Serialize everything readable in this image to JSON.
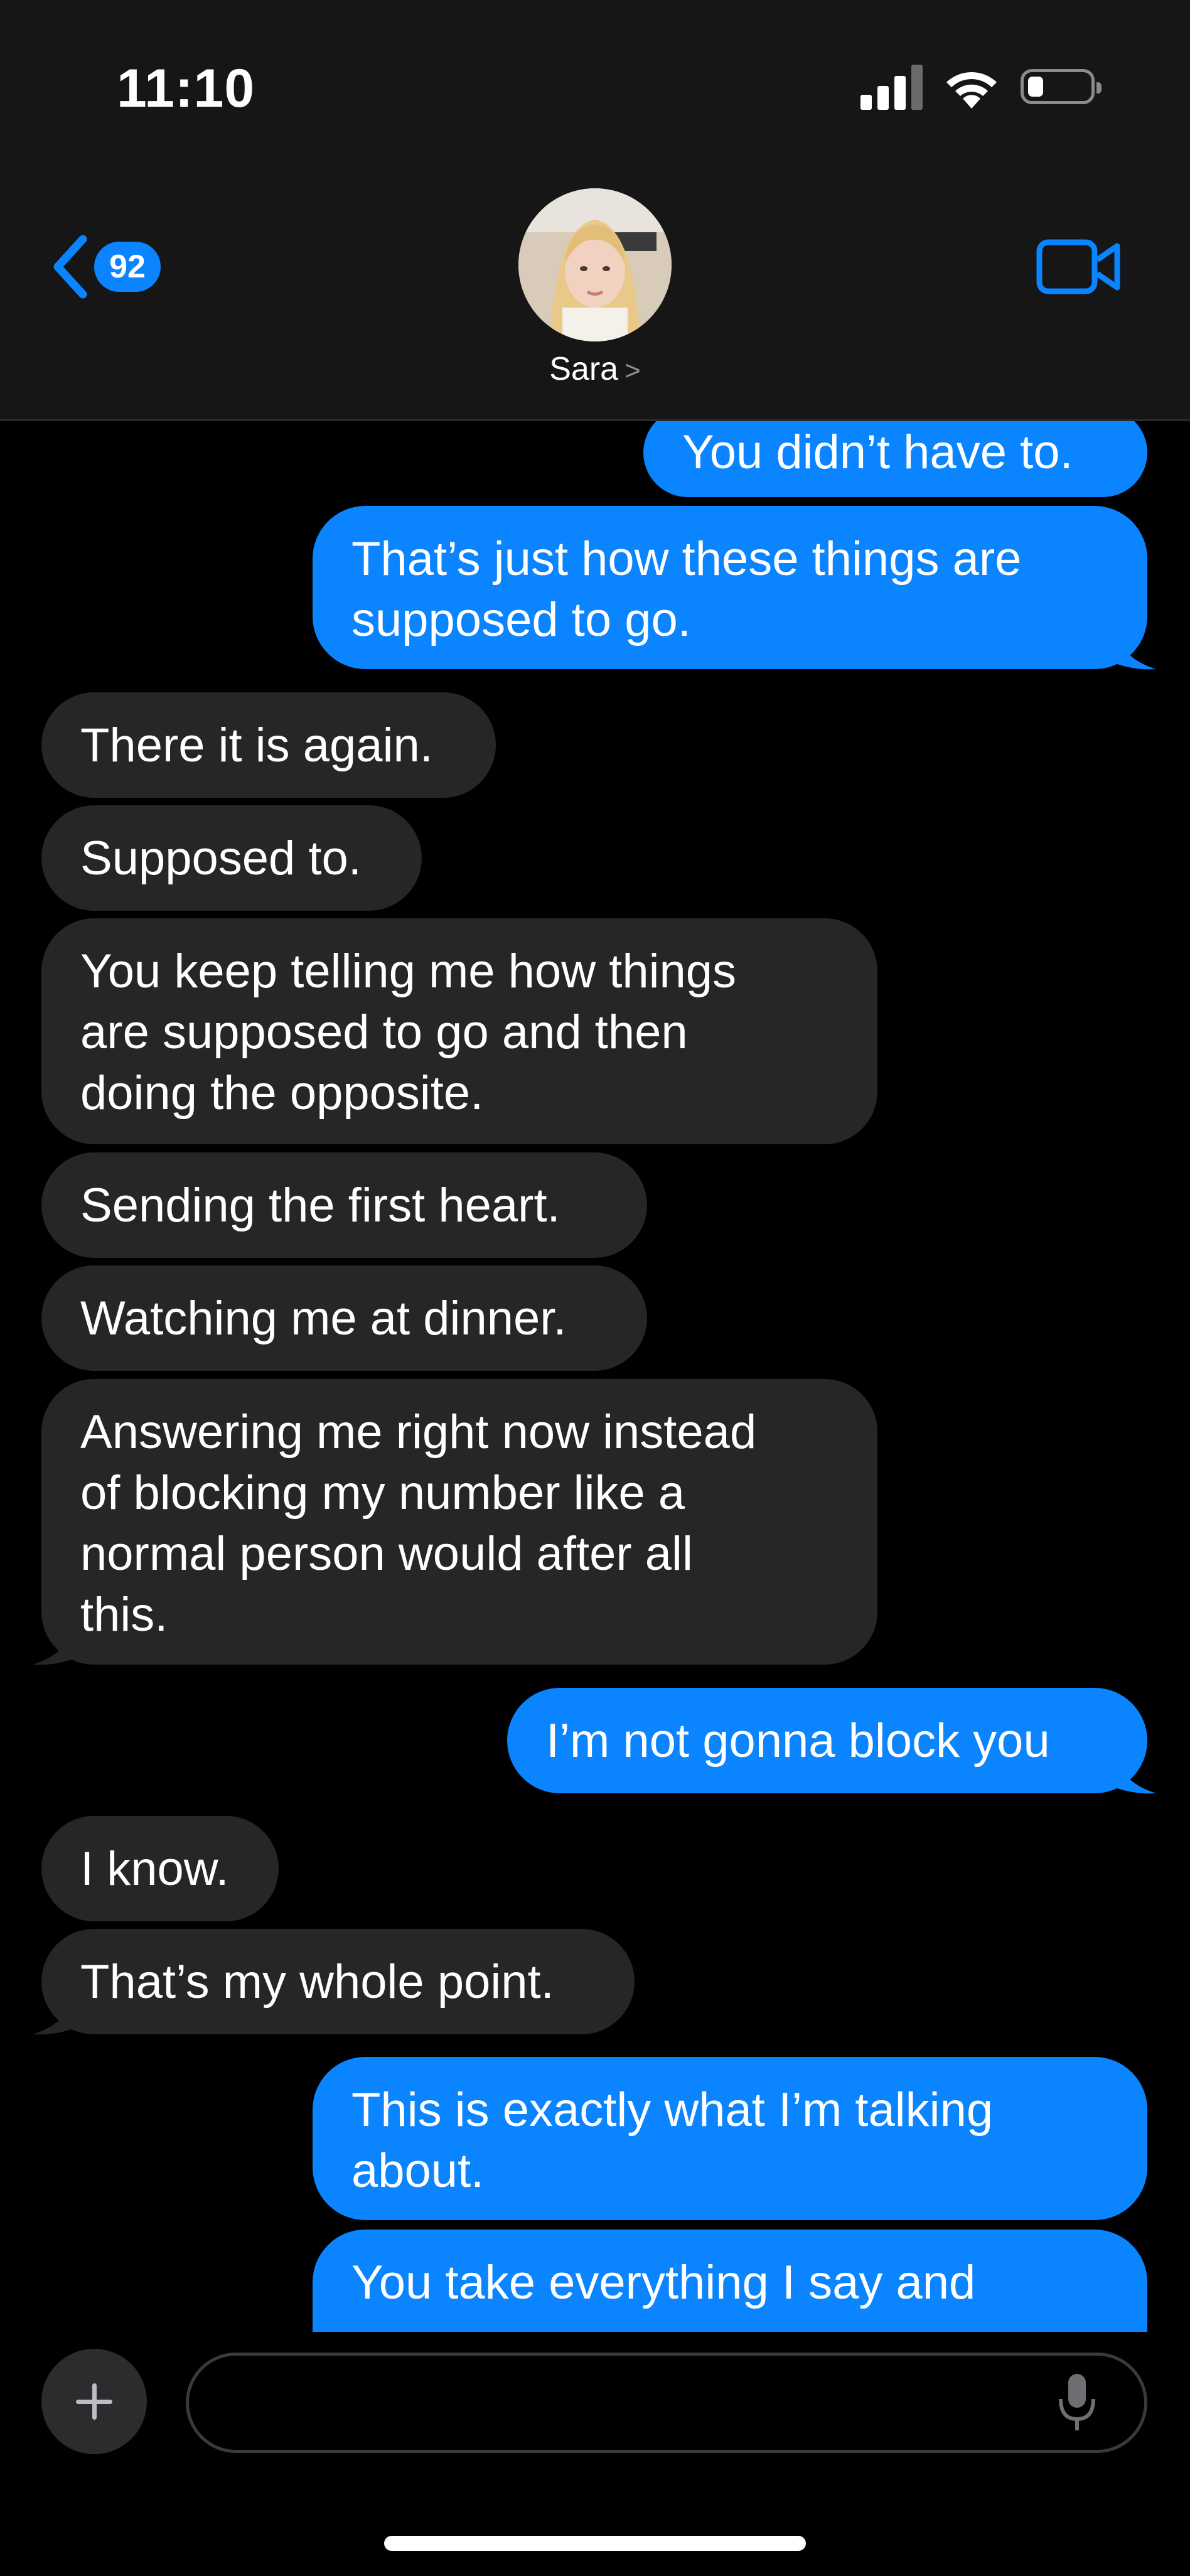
{
  "status_bar": {
    "time": "11:10"
  },
  "header": {
    "back_badge": "92",
    "contact_name": "Sara",
    "chevron": ">"
  },
  "messages": [
    {
      "side": "sent",
      "lines": [
        "You didn’t have to."
      ]
    },
    {
      "side": "sent",
      "lines": [
        "That’s just how these things are",
        "supposed to go."
      ]
    },
    {
      "side": "received",
      "lines": [
        "There it is again."
      ]
    },
    {
      "side": "received",
      "lines": [
        "Supposed to."
      ]
    },
    {
      "side": "received",
      "lines": [
        "You keep telling me how things",
        "are supposed to go and then",
        "doing the opposite."
      ]
    },
    {
      "side": "received",
      "lines": [
        "Sending the first heart."
      ]
    },
    {
      "side": "received",
      "lines": [
        "Watching me at dinner."
      ]
    },
    {
      "side": "received",
      "lines": [
        "Answering me right now instead",
        "of blocking my number like a",
        "normal person would after all",
        "this."
      ]
    },
    {
      "side": "sent",
      "lines": [
        "I’m not gonna block you"
      ]
    },
    {
      "side": "received",
      "lines": [
        "I know."
      ]
    },
    {
      "side": "received",
      "lines": [
        "That’s my whole point."
      ]
    },
    {
      "side": "sent",
      "lines": [
        "This is exactly what I’m talking",
        "about."
      ]
    },
    {
      "side": "sent",
      "lines": [
        "You take everything I say and"
      ]
    }
  ],
  "composer": {
    "placeholder": ""
  },
  "colors": {
    "sent": "#0a84ff",
    "received": "#262628",
    "background": "#000000"
  },
  "icons": [
    "back-chevron-icon",
    "video-camera-icon",
    "plus-icon",
    "microphone-icon",
    "wifi-icon",
    "signal-icon",
    "battery-icon"
  ]
}
